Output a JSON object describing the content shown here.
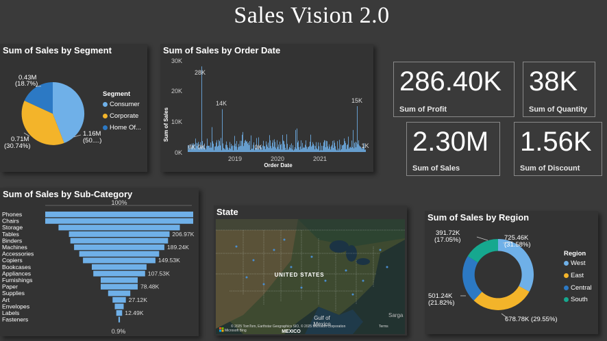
{
  "dashboard": {
    "title": "Sales Vision 2.0"
  },
  "colors": {
    "west": "#6fb0e8",
    "east": "#f3b42a",
    "central": "#2c79c4",
    "south": "#16a88f",
    "consumer": "#6fb0e8",
    "corporate": "#f3b42a",
    "homeoffice": "#2c79c4",
    "bar": "#6fb0e8"
  },
  "segment": {
    "title": "Sum of Sales by Segment",
    "legend_title": "Segment",
    "legend": [
      {
        "label": "Consumer",
        "color": "#6fb0e8"
      },
      {
        "label": "Corporate",
        "color": "#f3b42a"
      },
      {
        "label": "Home Of...",
        "color": "#2c79c4"
      }
    ],
    "labels": {
      "home_value": "0.43M",
      "home_pct": "(18.7%)",
      "corp_value": "0.71M",
      "corp_pct": "(30.74%)",
      "cons_value": "1.16M",
      "cons_pct": "(50....)"
    }
  },
  "order_date": {
    "title": "Sum of Sales by Order Date",
    "ylabel": "Sum of Sales",
    "xlabel": "Order Date",
    "yticks": [
      "30K",
      "20K",
      "10K",
      "0K"
    ],
    "xticks": [
      "2019",
      "2020",
      "2021"
    ],
    "annotations": {
      "peak1": "28K",
      "peak2": "14K",
      "peak3": "15K",
      "low1": "0K",
      "low2": "0K",
      "low3": "0K",
      "end": "1K"
    }
  },
  "kpis": [
    {
      "value": "286.40K",
      "label": "Sum of Profit"
    },
    {
      "value": "38K",
      "label": "Sum of Quantity"
    },
    {
      "value": "2.30M",
      "label": "Sum of Sales"
    },
    {
      "value": "1.56K",
      "label": "Sum of Discount"
    }
  ],
  "subcategory": {
    "title": "Sum of Sales by Sub-Category",
    "top_label": "100%",
    "bottom_label": "0.9%",
    "categories": [
      "Phones",
      "Chairs",
      "Storage",
      "Tables",
      "Binders",
      "Machines",
      "Accessories",
      "Copiers",
      "Bookcases",
      "Appliances",
      "Furnishings",
      "Paper",
      "Supplies",
      "Art",
      "Envelopes",
      "Labels",
      "Fasteners"
    ],
    "values": [
      100,
      100,
      82,
      68,
      66,
      61,
      54,
      49,
      37,
      35,
      25,
      25,
      15,
      9,
      6,
      4,
      1
    ],
    "value_labels": [
      "",
      "",
      "",
      "206.97K",
      "",
      "189.24K",
      "",
      "149.53K",
      "",
      "107.53K",
      "",
      "78.48K",
      "",
      "27.12K",
      "",
      "12.49K",
      ""
    ]
  },
  "state": {
    "title": "State",
    "map_label": "UNITED STATES",
    "mexico": "MEXICO",
    "gulf1": "Gulf of",
    "gulf2": "Mexico",
    "sargasso": "Sarga",
    "copyright": "© 2025 TomTom, Earthstar Geographics SIO, © 2025 Microsoft Corporation",
    "terms": "Terms",
    "brand": "Microsoft Bing"
  },
  "region": {
    "title": "Sum of Sales by Region",
    "legend_title": "Region",
    "legend": [
      {
        "label": "West",
        "color": "#6fb0e8"
      },
      {
        "label": "East",
        "color": "#f3b42a"
      },
      {
        "label": "Central",
        "color": "#2c79c4"
      },
      {
        "label": "South",
        "color": "#16a88f"
      }
    ],
    "labels": {
      "west_value": "725.46K",
      "west_pct": "(31.58%)",
      "east_label": "678.78K (29.55%)",
      "central_value": "501.24K",
      "central_pct": "(21.82%)",
      "south_value": "391.72K",
      "south_pct": "(17.05%)"
    }
  }
}
